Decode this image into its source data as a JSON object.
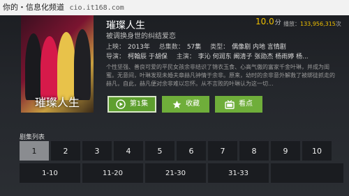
{
  "watermark": {
    "text": "你的・信息化频道",
    "site": "cio.it168.com"
  },
  "poster": {
    "title": "璀璨人生"
  },
  "show": {
    "title": "璀璨人生",
    "subtitle": "被调换身世的纠结爱恋",
    "score": "10.0",
    "score_unit": "分",
    "plays_label": "播放：",
    "plays_value": "133,956,315",
    "plays_unit": "次"
  },
  "info": {
    "release_key": "上映：",
    "release": "2013年",
    "episodes_key": "总集数：",
    "episodes": "57集",
    "genre_key": "类型：",
    "genre": "偶像剧 内地 言情剧",
    "director_key": "导演：",
    "director": "柯翰辰 于胡保",
    "cast_key": "主演：",
    "cast": "李沁 何润东 阚清子 张勋杰 杨雨婷 杨..."
  },
  "description": "个性坚强、善良可爱的平民女孩余非结识了锦衣玉食、心高气傲的富家千金叶琳，并成为闺蜜。无意间，叶琳发现未婚夫章赫凡钟情于余非。原来，幼时的余非意外解救了被绑徒抓走的赫凡，自此，赫凡便对余非难以忘怀。从不言败的叶琳认为这一切...",
  "buttons": {
    "play": "第1集",
    "fav": "收藏",
    "watch": "看点"
  },
  "episode_list": {
    "label": "剧集列表",
    "episodes": [
      "1",
      "2",
      "3",
      "4",
      "5",
      "6",
      "7",
      "8",
      "9",
      "10"
    ],
    "selected": "1",
    "ranges": [
      "1-10",
      "11-20",
      "21-30",
      "31-33"
    ]
  },
  "colors": {
    "accent": "#6fae3a",
    "score": "#f0c000",
    "selected_episode": "#8a8c90"
  },
  "icons": {
    "play": "play-icon",
    "fav": "star-icon",
    "watch": "tv-icon"
  }
}
